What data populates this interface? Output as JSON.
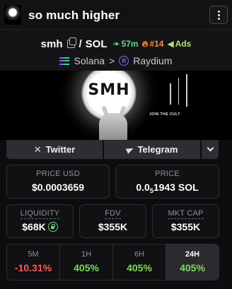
{
  "header": {
    "title": "so much higher"
  },
  "pair": {
    "base": "smh",
    "separator": "/",
    "quote": "SOL",
    "age": "57m",
    "rank": "#14",
    "ads": "Ads",
    "chain": "Solana",
    "chevron": ">",
    "dex": "Raydium"
  },
  "banner": {
    "moon_text": "SMH",
    "caption": "JOIN THE CULT"
  },
  "socials": {
    "twitter": "Twitter",
    "telegram": "Telegram"
  },
  "stats": {
    "price_usd": {
      "label": "PRICE USD",
      "value": "$0.0003659"
    },
    "price_sol": {
      "label": "PRICE",
      "prefix": "0.0",
      "sub": "5",
      "suffix": "1943 SOL"
    },
    "liquidity": {
      "label": "LIQUIDITY",
      "value": "$68K"
    },
    "fdv": {
      "label": "FDV",
      "value": "$355K"
    },
    "mkt_cap": {
      "label": "MKT CAP",
      "value": "$355K"
    }
  },
  "timeframes": [
    {
      "label": "5M",
      "value": "-10.31%"
    },
    {
      "label": "1H",
      "value": "405%"
    },
    {
      "label": "6H",
      "value": "405%"
    },
    {
      "label": "24H",
      "value": "405%"
    }
  ],
  "colors": {
    "positive": "#7ed957",
    "negative": "#ff5a5a",
    "rank": "#ff8c3b",
    "age": "#6bd38a"
  }
}
